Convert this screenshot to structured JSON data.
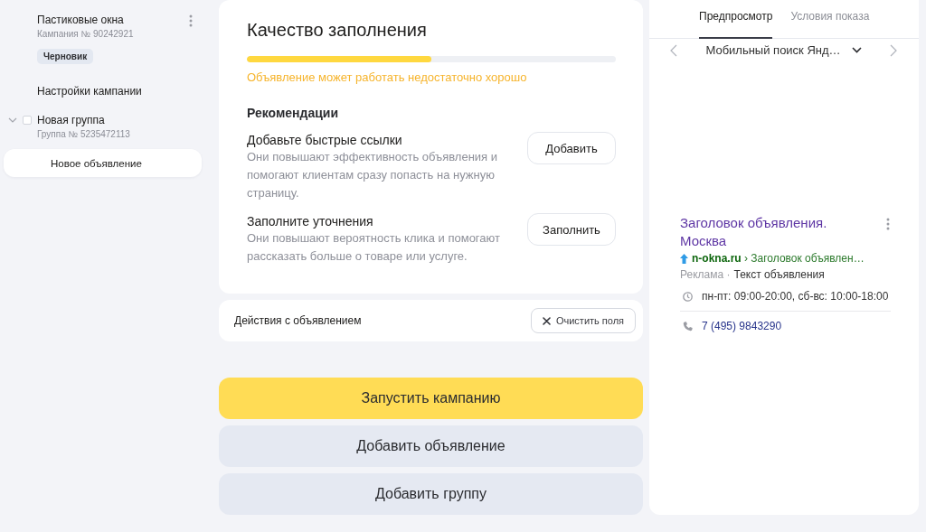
{
  "sidebar": {
    "campaign": {
      "title": "Пастиковые окна",
      "number": "Кампания № 90242921",
      "status": "Черновик"
    },
    "items": [
      {
        "kind": "link",
        "label": "Настройки кампании",
        "selected": false
      },
      {
        "kind": "group",
        "label": "Новая группа",
        "number": "Группа № 5235472113",
        "expanded": true,
        "checked": false,
        "selected": false,
        "children": [
          {
            "kind": "link",
            "label": "Новое объявление",
            "selected": true
          }
        ]
      }
    ]
  },
  "quality": {
    "title": "Качество заполнения",
    "level": 0.5,
    "message": "Объявление может работать недостаточно хорошо",
    "recommendations_title": "Рекомендации",
    "recommendations": [
      {
        "title": "Добавьте быстрые ссылки",
        "description": "Они повышают эффективность объявления и помогают клиентам сразу попасть на нужную страницу.",
        "button": "Добавить"
      },
      {
        "title": "Заполните уточнения",
        "description": "Они повышают вероятность клика и помогают рассказать больше о товаре или услуге.",
        "button": "Заполнить"
      }
    ]
  },
  "actions": {
    "label": "Действия с объявлением",
    "button": "Очистить поля"
  },
  "main_buttons": [
    {
      "kind": "primary",
      "label": "Запустить кампанию"
    },
    {
      "kind": "secondary",
      "label": "Добавить объявление"
    },
    {
      "kind": "secondary",
      "label": "Добавить группу"
    }
  ],
  "preview": {
    "tabs": [
      {
        "label": "Предпросмотр",
        "selected": true
      },
      {
        "label": "Условия показа",
        "selected": false
      }
    ],
    "device": "Мобильный поиск Янд…",
    "ad": {
      "title": "Заголовок объявления. Москва",
      "url": "**n-okna.ru** › Заголовок объявлен…",
      "label": "Реклама ·",
      "text": "Текст объявления",
      "hours": "пн-пт: 09:00-20:00, сб-вс: 10:00-18:00",
      "phone": "7 (495) 9843290"
    }
  }
}
